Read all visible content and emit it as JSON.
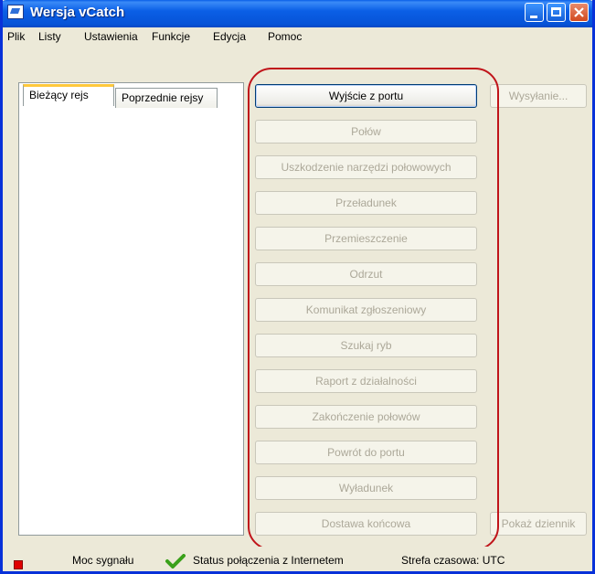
{
  "window": {
    "title": "Wersja vCatch"
  },
  "menu": [
    "Plik",
    "Listy",
    "Ustawienia",
    "Funkcje",
    "Edycja",
    "Pomoc"
  ],
  "tabs": {
    "current": "Bieżący rejs",
    "previous": "Poprzednie rejsy"
  },
  "actions": [
    "Wyjście z portu",
    "Połów",
    "Uszkodzenie narzędzi połowowych",
    "Przeładunek",
    "Przemieszczenie",
    "Odrzut",
    "Komunikat zgłoszeniowy",
    "Szukaj ryb",
    "Raport z działalności",
    "Zakończenie połowów",
    "Powrót do portu",
    "Wyładunek",
    "Dostawa końcowa"
  ],
  "side_buttons": {
    "send": "Wysyłanie...",
    "show_log": "Pokaż dziennik"
  },
  "status": {
    "signal": "Moc sygnału",
    "connection": "Status połączenia z Internetem",
    "timezone": "Strefa czasowa: UTC"
  },
  "colors": {
    "title_bar": "#0653d7",
    "highlight": "#c0141a",
    "signal_indicator": "#e00000",
    "connection_ok": "#3aa11a"
  },
  "icons": {
    "signal": "red-square-icon",
    "connection": "green-check-icon"
  }
}
